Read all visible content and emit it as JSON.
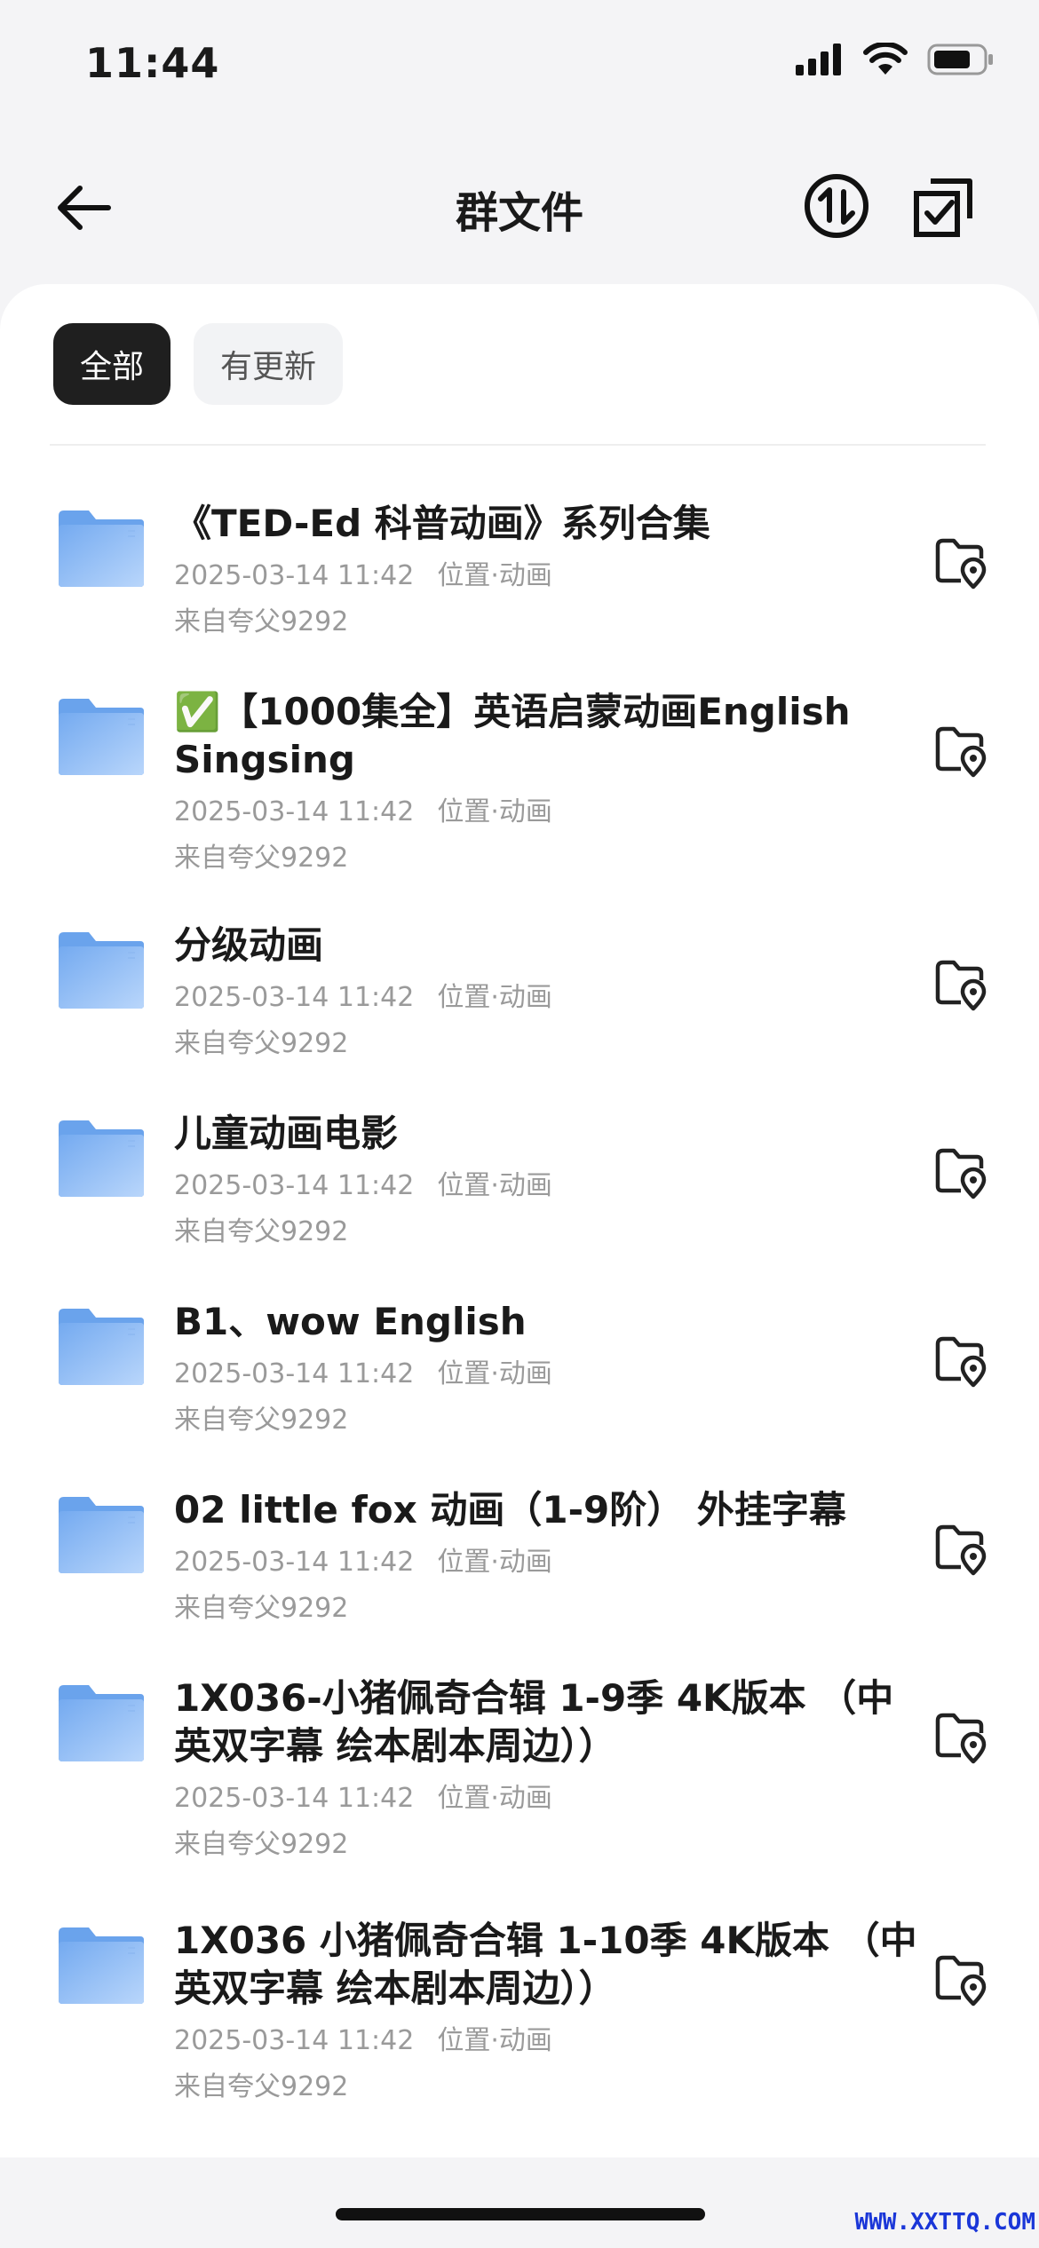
{
  "status_bar": {
    "time": "11:44"
  },
  "nav": {
    "title": "群文件"
  },
  "filters": [
    {
      "label": "全部",
      "active": true
    },
    {
      "label": "有更新",
      "active": false
    }
  ],
  "files": [
    {
      "name": "《TED-Ed 科普动画》系列合集",
      "date": "2025-03-14 11:42",
      "location": "位置·动画",
      "from": "来自夸父9292",
      "icon": "folder-icon"
    },
    {
      "name": "✅【1000集全】英语启蒙动画English Singsing",
      "date": "2025-03-14 11:42",
      "location": "位置·动画",
      "from": "来自夸父9292",
      "icon": "folder-icon"
    },
    {
      "name": "分级动画",
      "date": "2025-03-14 11:42",
      "location": "位置·动画",
      "from": "来自夸父9292",
      "icon": "folder-icon"
    },
    {
      "name": "儿童动画电影",
      "date": "2025-03-14 11:42",
      "location": "位置·动画",
      "from": "来自夸父9292",
      "icon": "folder-icon"
    },
    {
      "name": "B1、wow  English",
      "date": "2025-03-14 11:42",
      "location": "位置·动画",
      "from": "来自夸父9292",
      "icon": "folder-icon"
    },
    {
      "name": "02 little fox 动画（1-9阶） 外挂字幕",
      "date": "2025-03-14 11:42",
      "location": "位置·动画",
      "from": "来自夸父9292",
      "icon": "folder-icon"
    },
    {
      "name": "1X036-小猪佩奇合辑 1-9季 4K版本 （中英双字幕 绘本剧本周边））",
      "date": "2025-03-14 11:42",
      "location": "位置·动画",
      "from": "来自夸父9292",
      "icon": "folder-icon"
    },
    {
      "name": "1X036 小猪佩奇合辑 1-10季 4K版本 （中英双字幕 绘本剧本周边））",
      "date": "2025-03-14 11:42",
      "location": "位置·动画",
      "from": "来自夸父9292",
      "icon": "folder-icon"
    }
  ],
  "watermark": "WWW.XXTTQ.COM",
  "colors": {
    "folder": "#7fb3f0",
    "active_chip": "#1f1f1f",
    "meta_text": "#9a9a9a"
  }
}
